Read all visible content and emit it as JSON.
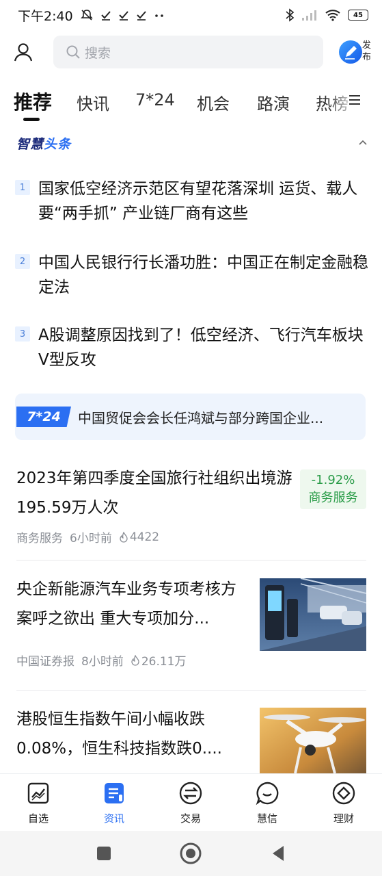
{
  "status_bar": {
    "time": "下午2:40",
    "battery": "45",
    "icons": [
      "mute-bell-icon",
      "check-icon",
      "check-icon",
      "check-icon",
      "more-dots-icon",
      "bluetooth-icon",
      "signal-icon",
      "wifi-icon",
      "battery-icon"
    ]
  },
  "header": {
    "search_placeholder": "搜索",
    "publish_label": "发布"
  },
  "tabs": [
    {
      "label": "推荐",
      "active": true
    },
    {
      "label": "快讯"
    },
    {
      "label": "7*24"
    },
    {
      "label": "机会"
    },
    {
      "label": "路演"
    },
    {
      "label": "热榜"
    }
  ],
  "section": {
    "title_part1": "智慧",
    "title_part2": "头条"
  },
  "headlines": [
    {
      "num": "1",
      "text": "国家低空经济示范区有望花落深圳 运货、载人要“两手抓” 产业链厂商有这些"
    },
    {
      "num": "2",
      "text": "中国人民银行行长潘功胜：中国正在制定金融稳定法"
    },
    {
      "num": "3",
      "text": "A股调整原因找到了！低空经济、飞行汽车板块V型反攻"
    }
  ],
  "banner": {
    "badge": "7*24",
    "text": "中国贸促会会长任鸿斌与部分跨国企业..."
  },
  "articles": [
    {
      "title": "2023年第四季度全国旅行社组织出境游195.59万人次",
      "source": "商务服务",
      "time": "6小时前",
      "views": "4422",
      "tag_pct": "-1.92%",
      "tag_sector": "商务服务"
    },
    {
      "title": "央企新能源汽车业务专项考核方案呼之欲出 重大专项加分...",
      "source": "中国证券报",
      "time": "8小时前",
      "views": "26.11万"
    },
    {
      "title": "港股恒生指数午间小幅收跌0.08%，恒生科技指数跌0...."
    }
  ],
  "bottom_nav": [
    {
      "label": "自选",
      "icon": "chart-icon"
    },
    {
      "label": "资讯",
      "icon": "news-icon",
      "active": true
    },
    {
      "label": "交易",
      "icon": "exchange-icon"
    },
    {
      "label": "慧信",
      "icon": "chat-icon"
    },
    {
      "label": "理财",
      "icon": "finance-icon"
    }
  ],
  "colors": {
    "accent": "#2b6ff2",
    "up_down_green": "#2a9c48",
    "search_bg": "#f2f3f5",
    "banner_bg": "#eef4fd"
  }
}
